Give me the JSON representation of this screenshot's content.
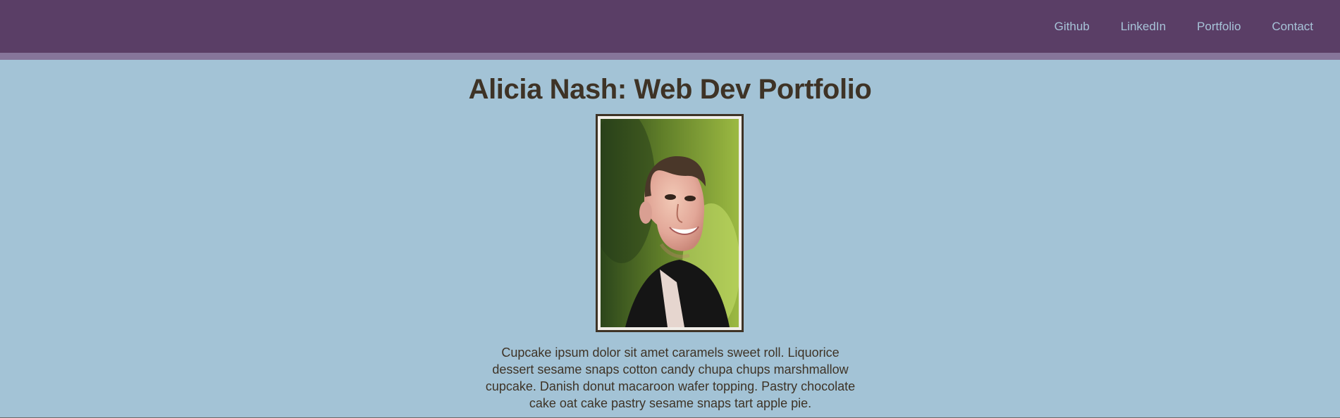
{
  "nav": {
    "items": [
      {
        "label": "Github"
      },
      {
        "label": "LinkedIn"
      },
      {
        "label": "Portfolio"
      },
      {
        "label": "Contact"
      }
    ]
  },
  "hero": {
    "title": "Alicia Nash: Web Dev Portfolio",
    "bio": "Cupcake ipsum dolor sit amet caramels sweet roll. Liquorice dessert sesame snaps cotton candy chupa chups marshmallow cupcake. Danish donut macaroon wafer topping. Pastry chocolate cake oat cake pastry sesame snaps tart apple pie."
  },
  "colors": {
    "header_bg": "#5a3e66",
    "header_stripe": "#86759a",
    "page_bg": "#a3c3d6",
    "text": "#3e3326",
    "nav_text": "#a7c3d8"
  }
}
